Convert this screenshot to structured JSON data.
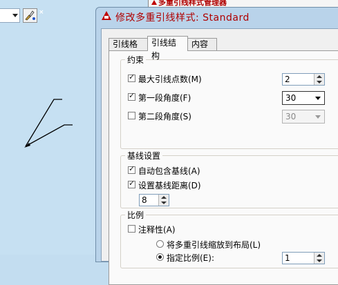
{
  "dialog": {
    "title": "修改多重引线样式: Standard",
    "tabs": [
      {
        "label": "引线格式"
      },
      {
        "label": "引线结构"
      },
      {
        "label": "内容"
      }
    ],
    "active_tab": "引线结构"
  },
  "background_window": {
    "title": "多重引线样式管理器"
  },
  "constraints": {
    "title": "约束",
    "max_points": {
      "label": "最大引线点数(M)",
      "checked": true,
      "value": "2"
    },
    "first_angle": {
      "label": "第一段角度(F)",
      "checked": true,
      "value": "30"
    },
    "second_angle": {
      "label": "第二段角度(S)",
      "checked": false,
      "value": "30"
    }
  },
  "landing": {
    "title": "基线设置",
    "auto_include": {
      "label": "自动包含基线(A)",
      "checked": true
    },
    "set_distance": {
      "label": "设置基线距离(D)",
      "checked": true,
      "value": "8"
    }
  },
  "scale": {
    "title": "比例",
    "annotative": {
      "label": "注释性(A)",
      "checked": false
    },
    "scale_to_layout": {
      "label": "将多重引线缩放到布局(L)",
      "selected": false
    },
    "specify_scale": {
      "label": "指定比例(E):",
      "selected": true,
      "value": "1"
    }
  },
  "icons": {
    "toolbar_button": "style-brush-icon",
    "close": "close-icon",
    "dialog": "autocad-logo-icon"
  }
}
